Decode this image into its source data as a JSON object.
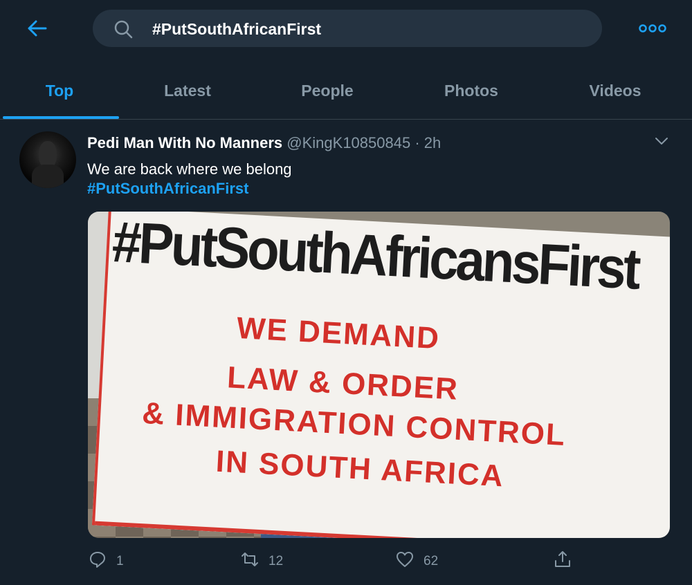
{
  "search": {
    "query": "#PutSouthAfricanFirst"
  },
  "icons": {
    "back": "arrow-left-icon",
    "search": "search-icon",
    "more": "more-options-icon",
    "caret": "chevron-down-icon",
    "reply": "reply-icon",
    "retweet": "retweet-icon",
    "like": "heart-icon",
    "share": "share-icon"
  },
  "tabs": [
    {
      "label": "Top",
      "active": true
    },
    {
      "label": "Latest",
      "active": false
    },
    {
      "label": "People",
      "active": false
    },
    {
      "label": "Photos",
      "active": false
    },
    {
      "label": "Videos",
      "active": false
    }
  ],
  "tweet": {
    "author_name": "Pedi Man With No Manners",
    "handle": "@KingK10850845",
    "separator": "·",
    "time": "2h",
    "text": "We are back where we belong",
    "hashtag": "#PutSouthAfricanFirst",
    "media": {
      "headline": "#PutSouthAfricansFirst",
      "lines": [
        "WE DEMAND",
        "LAW & ORDER",
        "& IMMIGRATION CONTROL",
        "IN SOUTH AFRICA"
      ]
    },
    "counts": {
      "replies": "1",
      "retweets": "12",
      "likes": "62"
    }
  },
  "colors": {
    "background": "#15202b",
    "accent": "#1da1f2",
    "muted": "#8899a6",
    "banner_red": "#d3302a"
  }
}
